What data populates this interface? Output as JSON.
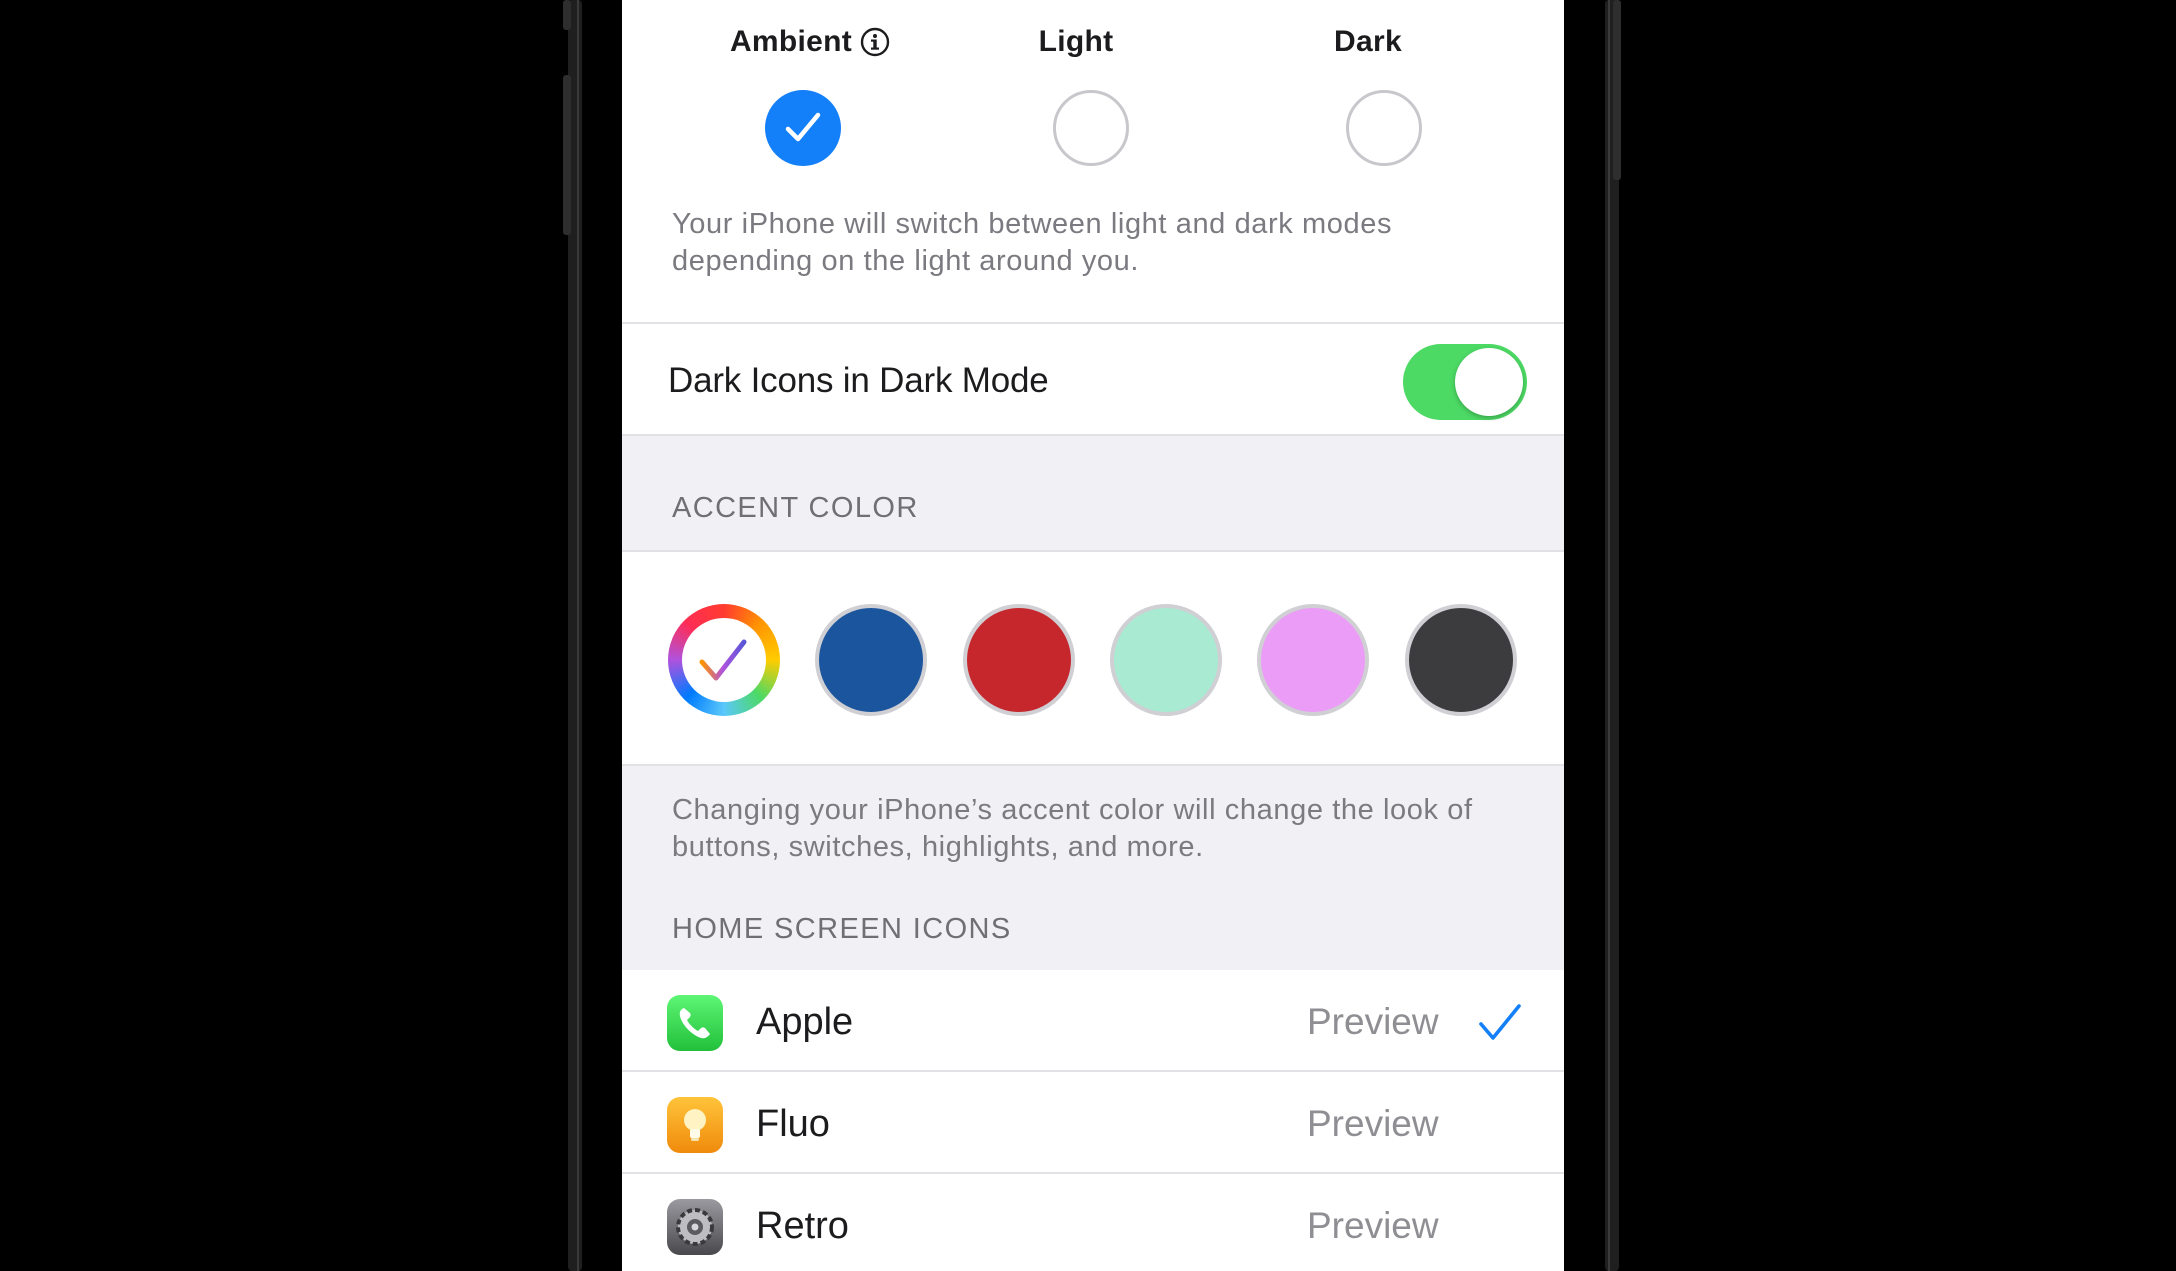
{
  "appearance": {
    "modes": [
      {
        "label": "Ambient",
        "selected": true,
        "icon": "info-icon"
      },
      {
        "label": "Light",
        "selected": false
      },
      {
        "label": "Dark",
        "selected": false
      }
    ],
    "description": "Your iPhone will switch between light and dark modes depending on the light around you."
  },
  "dark_icons": {
    "label": "Dark Icons in Dark Mode",
    "enabled": true
  },
  "accent_color": {
    "header": "ACCENT COLOR",
    "swatches": [
      {
        "name": "multicolor",
        "color": "multicolor",
        "selected": true
      },
      {
        "name": "blue",
        "color": "#1a559e",
        "selected": false
      },
      {
        "name": "red",
        "color": "#c5272d",
        "selected": false
      },
      {
        "name": "mint",
        "color": "#a8ebd2",
        "selected": false
      },
      {
        "name": "pink",
        "color": "#eb9cf7",
        "selected": false
      },
      {
        "name": "graphite",
        "color": "#3c3c3e",
        "selected": false
      }
    ],
    "description": "Changing your iPhone’s accent color will change the look of buttons, switches, highlights, and more."
  },
  "home_screen_icons": {
    "header": "HOME SCREEN ICONS",
    "items": [
      {
        "name": "Apple",
        "action": "Preview",
        "selected": true,
        "icon": "phone-app-icon"
      },
      {
        "name": "Fluo",
        "action": "Preview",
        "selected": false,
        "icon": "lightbulb-app-icon"
      },
      {
        "name": "Retro",
        "action": "Preview",
        "selected": false,
        "icon": "settings-gear-app-icon"
      }
    ]
  },
  "colors": {
    "accent_blue": "#137ff8",
    "toggle_green": "#4cd964",
    "grouped_background": "#f1f0f5"
  }
}
